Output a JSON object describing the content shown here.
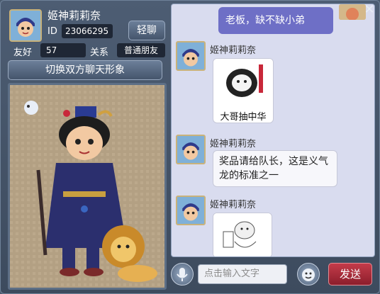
{
  "profile": {
    "name": "姬神莉莉奈",
    "id_label": "ID",
    "id_value": "23066295",
    "whisper_button": "轻聊",
    "favor_label": "友好",
    "favor_value": "57",
    "relation_label": "关系",
    "relation_value": "普通朋友",
    "switch_button": "切换双方聊天形象"
  },
  "chat": {
    "messages": [
      {
        "from": "self",
        "text": "老板，缺不缺小弟"
      },
      {
        "from": "姬神莉莉奈",
        "type": "image",
        "caption": "大哥抽中华"
      },
      {
        "from": "姬神莉莉奈",
        "type": "text",
        "text": "奖品请给队长，这是义气龙的标准之一"
      },
      {
        "from": "姬神莉莉奈",
        "type": "image",
        "caption": ""
      }
    ]
  },
  "input": {
    "placeholder": "点击输入文字",
    "send_button": "发送"
  },
  "icons": {
    "close": "close-icon",
    "voice": "microphone-icon",
    "emoji": "emoji-face-icon"
  },
  "colors": {
    "self_bubble": "#6e6fc6",
    "send_button": "#c43b4a",
    "chat_bg": "#d9dcef"
  }
}
